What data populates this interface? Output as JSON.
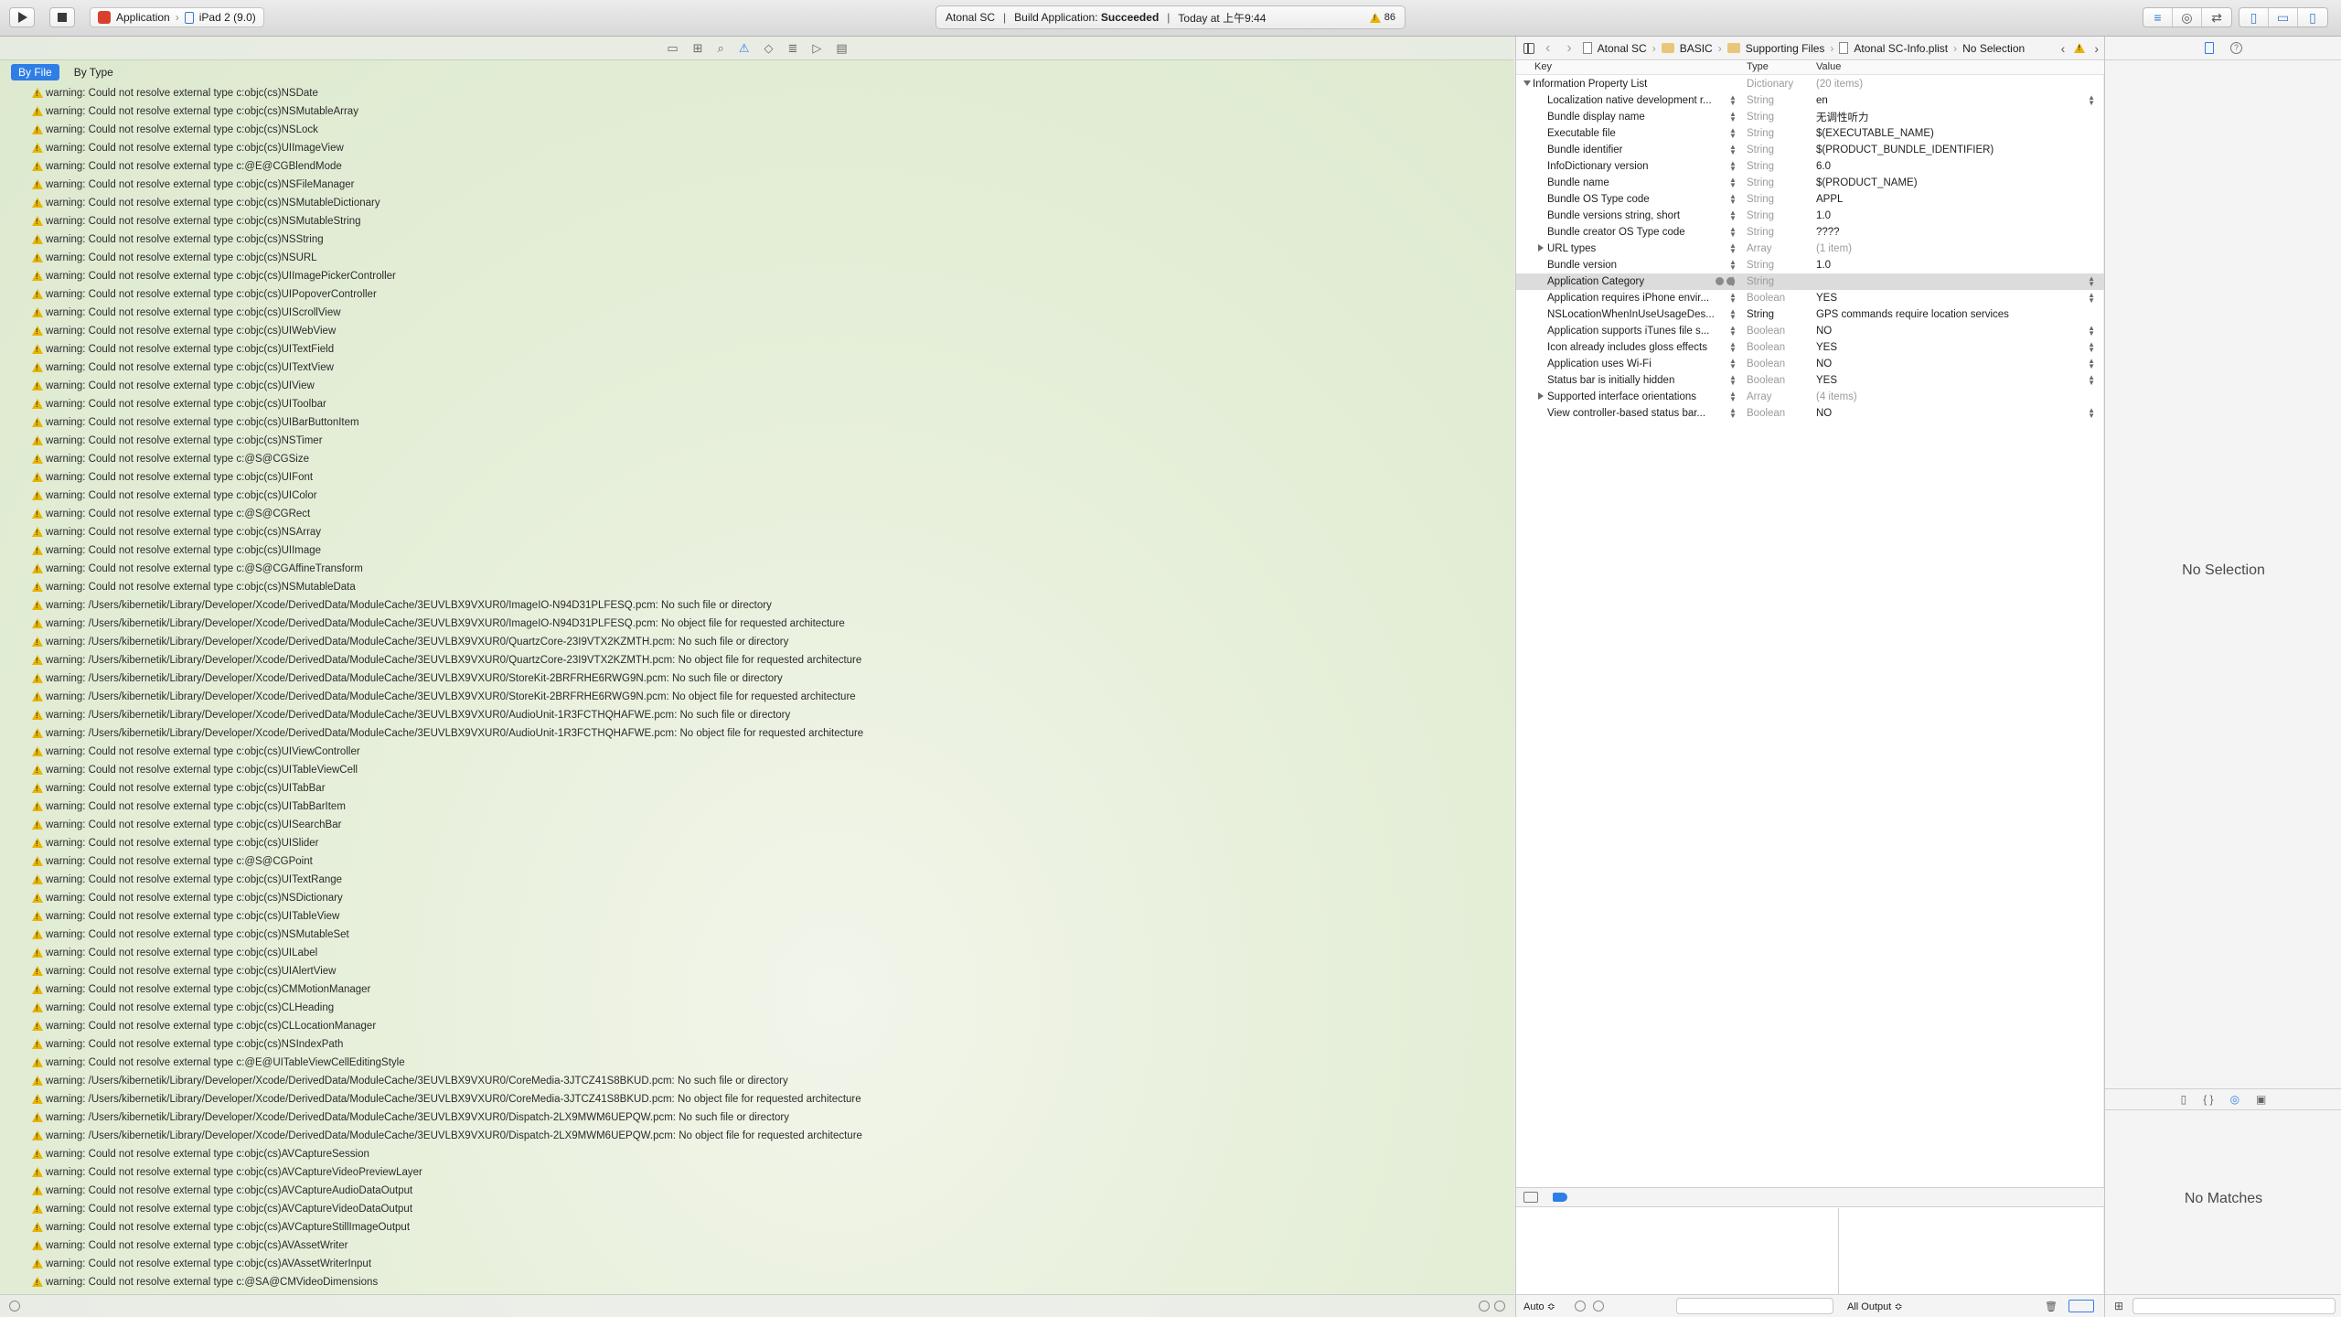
{
  "toolbar": {
    "scheme": "Application",
    "destination": "iPad 2 (9.0)",
    "activity_project": "Atonal SC",
    "activity_action": "Build Application:",
    "activity_status": "Succeeded",
    "activity_time": "Today at 上午9:44",
    "warning_count": "86"
  },
  "issue_navigator": {
    "filter_by_file": "By File",
    "filter_by_type": "By Type",
    "issues": [
      "warning: Could not resolve external type c:objc(cs)NSDate",
      "warning: Could not resolve external type c:objc(cs)NSMutableArray",
      "warning: Could not resolve external type c:objc(cs)NSLock",
      "warning: Could not resolve external type c:objc(cs)UIImageView",
      "warning: Could not resolve external type c:@E@CGBlendMode",
      "warning: Could not resolve external type c:objc(cs)NSFileManager",
      "warning: Could not resolve external type c:objc(cs)NSMutableDictionary",
      "warning: Could not resolve external type c:objc(cs)NSMutableString",
      "warning: Could not resolve external type c:objc(cs)NSString",
      "warning: Could not resolve external type c:objc(cs)NSURL",
      "warning: Could not resolve external type c:objc(cs)UIImagePickerController",
      "warning: Could not resolve external type c:objc(cs)UIPopoverController",
      "warning: Could not resolve external type c:objc(cs)UIScrollView",
      "warning: Could not resolve external type c:objc(cs)UIWebView",
      "warning: Could not resolve external type c:objc(cs)UITextField",
      "warning: Could not resolve external type c:objc(cs)UITextView",
      "warning: Could not resolve external type c:objc(cs)UIView",
      "warning: Could not resolve external type c:objc(cs)UIToolbar",
      "warning: Could not resolve external type c:objc(cs)UIBarButtonItem",
      "warning: Could not resolve external type c:objc(cs)NSTimer",
      "warning: Could not resolve external type c:@S@CGSize",
      "warning: Could not resolve external type c:objc(cs)UIFont",
      "warning: Could not resolve external type c:objc(cs)UIColor",
      "warning: Could not resolve external type c:@S@CGRect",
      "warning: Could not resolve external type c:objc(cs)NSArray",
      "warning: Could not resolve external type c:objc(cs)UIImage",
      "warning: Could not resolve external type c:@S@CGAffineTransform",
      "warning: Could not resolve external type c:objc(cs)NSMutableData",
      "warning: /Users/kibernetik/Library/Developer/Xcode/DerivedData/ModuleCache/3EUVLBX9VXUR0/ImageIO-N94D31PLFESQ.pcm: No such file or directory",
      "warning: /Users/kibernetik/Library/Developer/Xcode/DerivedData/ModuleCache/3EUVLBX9VXUR0/ImageIO-N94D31PLFESQ.pcm: No object file for requested architecture",
      "warning: /Users/kibernetik/Library/Developer/Xcode/DerivedData/ModuleCache/3EUVLBX9VXUR0/QuartzCore-23I9VTX2KZMTH.pcm: No such file or directory",
      "warning: /Users/kibernetik/Library/Developer/Xcode/DerivedData/ModuleCache/3EUVLBX9VXUR0/QuartzCore-23I9VTX2KZMTH.pcm: No object file for requested architecture",
      "warning: /Users/kibernetik/Library/Developer/Xcode/DerivedData/ModuleCache/3EUVLBX9VXUR0/StoreKit-2BRFRHE6RWG9N.pcm: No such file or directory",
      "warning: /Users/kibernetik/Library/Developer/Xcode/DerivedData/ModuleCache/3EUVLBX9VXUR0/StoreKit-2BRFRHE6RWG9N.pcm: No object file for requested architecture",
      "warning: /Users/kibernetik/Library/Developer/Xcode/DerivedData/ModuleCache/3EUVLBX9VXUR0/AudioUnit-1R3FCTHQHAFWE.pcm: No such file or directory",
      "warning: /Users/kibernetik/Library/Developer/Xcode/DerivedData/ModuleCache/3EUVLBX9VXUR0/AudioUnit-1R3FCTHQHAFWE.pcm: No object file for requested architecture",
      "warning: Could not resolve external type c:objc(cs)UIViewController",
      "warning: Could not resolve external type c:objc(cs)UITableViewCell",
      "warning: Could not resolve external type c:objc(cs)UITabBar",
      "warning: Could not resolve external type c:objc(cs)UITabBarItem",
      "warning: Could not resolve external type c:objc(cs)UISearchBar",
      "warning: Could not resolve external type c:objc(cs)UISlider",
      "warning: Could not resolve external type c:@S@CGPoint",
      "warning: Could not resolve external type c:objc(cs)UITextRange",
      "warning: Could not resolve external type c:objc(cs)NSDictionary",
      "warning: Could not resolve external type c:objc(cs)UITableView",
      "warning: Could not resolve external type c:objc(cs)NSMutableSet",
      "warning: Could not resolve external type c:objc(cs)UILabel",
      "warning: Could not resolve external type c:objc(cs)UIAlertView",
      "warning: Could not resolve external type c:objc(cs)CMMotionManager",
      "warning: Could not resolve external type c:objc(cs)CLHeading",
      "warning: Could not resolve external type c:objc(cs)CLLocationManager",
      "warning: Could not resolve external type c:objc(cs)NSIndexPath",
      "warning: Could not resolve external type c:@E@UITableViewCellEditingStyle",
      "warning: /Users/kibernetik/Library/Developer/Xcode/DerivedData/ModuleCache/3EUVLBX9VXUR0/CoreMedia-3JTCZ41S8BKUD.pcm: No such file or directory",
      "warning: /Users/kibernetik/Library/Developer/Xcode/DerivedData/ModuleCache/3EUVLBX9VXUR0/CoreMedia-3JTCZ41S8BKUD.pcm: No object file for requested architecture",
      "warning: /Users/kibernetik/Library/Developer/Xcode/DerivedData/ModuleCache/3EUVLBX9VXUR0/Dispatch-2LX9MWM6UEPQW.pcm: No such file or directory",
      "warning: /Users/kibernetik/Library/Developer/Xcode/DerivedData/ModuleCache/3EUVLBX9VXUR0/Dispatch-2LX9MWM6UEPQW.pcm: No object file for requested architecture",
      "warning: Could not resolve external type c:objc(cs)AVCaptureSession",
      "warning: Could not resolve external type c:objc(cs)AVCaptureVideoPreviewLayer",
      "warning: Could not resolve external type c:objc(cs)AVCaptureAudioDataOutput",
      "warning: Could not resolve external type c:objc(cs)AVCaptureVideoDataOutput",
      "warning: Could not resolve external type c:objc(cs)AVCaptureStillImageOutput",
      "warning: Could not resolve external type c:objc(cs)AVAssetWriter",
      "warning: Could not resolve external type c:objc(cs)AVAssetWriterInput",
      "warning: Could not resolve external type c:@SA@CMVideoDimensions"
    ]
  },
  "breadcrumb": {
    "project": "Atonal SC",
    "group": "BASIC",
    "folder": "Supporting Files",
    "file": "Atonal SC-Info.plist",
    "selection": "No Selection"
  },
  "plist": {
    "col_key": "Key",
    "col_type": "Type",
    "col_value": "Value",
    "rows": [
      {
        "key": "Information Property List",
        "type": "Dictionary",
        "value": "(20 items)"
      },
      {
        "key": "Localization native development r...",
        "type": "String",
        "value": "en"
      },
      {
        "key": "Bundle display name",
        "type": "String",
        "value": "无调性听力"
      },
      {
        "key": "Executable file",
        "type": "String",
        "value": "$(EXECUTABLE_NAME)"
      },
      {
        "key": "Bundle identifier",
        "type": "String",
        "value": "$(PRODUCT_BUNDLE_IDENTIFIER)"
      },
      {
        "key": "InfoDictionary version",
        "type": "String",
        "value": "6.0"
      },
      {
        "key": "Bundle name",
        "type": "String",
        "value": "$(PRODUCT_NAME)"
      },
      {
        "key": "Bundle OS Type code",
        "type": "String",
        "value": "APPL"
      },
      {
        "key": "Bundle versions string, short",
        "type": "String",
        "value": "1.0"
      },
      {
        "key": "Bundle creator OS Type code",
        "type": "String",
        "value": "????"
      },
      {
        "key": "URL types",
        "type": "Array",
        "value": "(1 item)"
      },
      {
        "key": "Bundle version",
        "type": "String",
        "value": "1.0"
      },
      {
        "key": "Application Category",
        "type": "String",
        "value": ""
      },
      {
        "key": "Application requires iPhone envir...",
        "type": "Boolean",
        "value": "YES"
      },
      {
        "key": "NSLocationWhenInUseUsageDes...",
        "type": "String",
        "value": "GPS commands require location services"
      },
      {
        "key": "Application supports iTunes file s...",
        "type": "Boolean",
        "value": "NO"
      },
      {
        "key": "Icon already includes gloss effects",
        "type": "Boolean",
        "value": "YES"
      },
      {
        "key": "Application uses Wi-Fi",
        "type": "Boolean",
        "value": "NO"
      },
      {
        "key": "Status bar is initially hidden",
        "type": "Boolean",
        "value": "YES"
      },
      {
        "key": "Supported interface orientations",
        "type": "Array",
        "value": "(4 items)"
      },
      {
        "key": "View controller-based status bar...",
        "type": "Boolean",
        "value": "NO"
      }
    ]
  },
  "console": {
    "auto_label": "Auto ≎",
    "output_label": "All Output ≎"
  },
  "inspector": {
    "no_selection": "No Selection",
    "no_matches": "No Matches",
    "library_braces": "{ }"
  },
  "colors": {
    "accent": "#2f7ee6",
    "warning": "#e8b400"
  }
}
